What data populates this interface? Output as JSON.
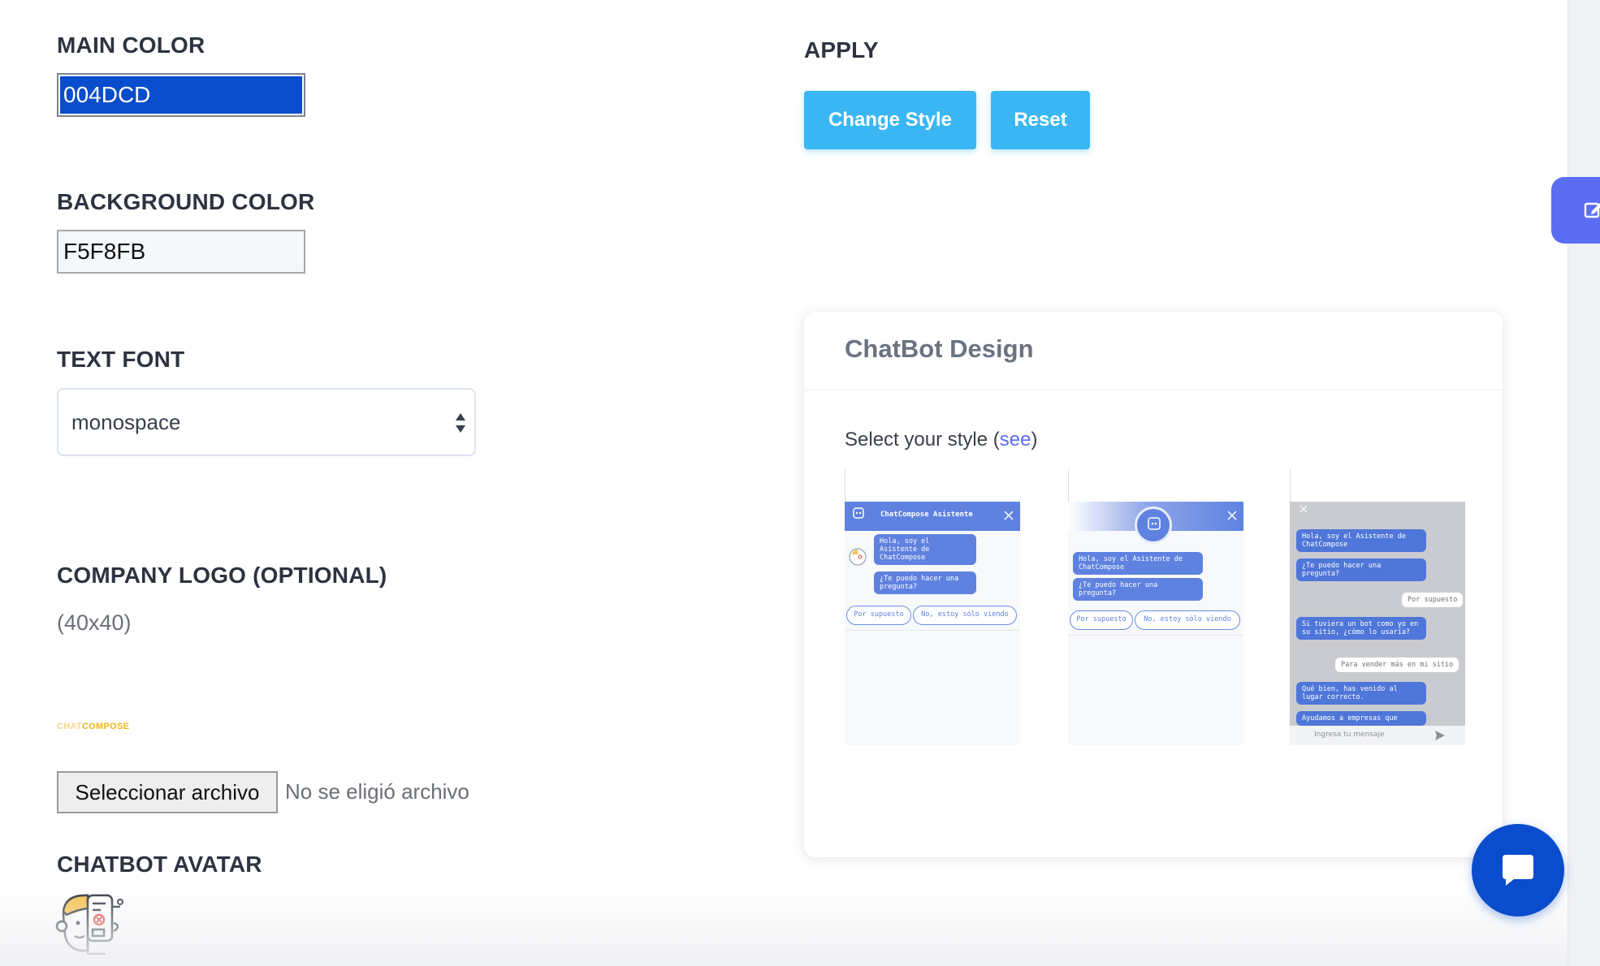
{
  "colors": {
    "main": "#004DCD",
    "background": "#F5F8FB",
    "button": "#3AB7F3",
    "accent": "#5B6EF2",
    "logo_light": "#F6D58A",
    "logo_dark": "#F0B41C"
  },
  "form": {
    "main_color": {
      "label": "MAIN COLOR",
      "value": "004DCD"
    },
    "background_color": {
      "label": "BACKGROUND COLOR",
      "value": "F5F8FB"
    },
    "text_font": {
      "label": "TEXT FONT",
      "value": "monospace"
    },
    "company_logo": {
      "label": "COMPANY LOGO (OPTIONAL)",
      "size_note": "(40x40)",
      "preview_text_a": "CHAT",
      "preview_text_b": "COMPOSE",
      "file_button": "Seleccionar archivo",
      "file_status": "No se eligió archivo"
    },
    "chatbot_avatar": {
      "label": "CHATBOT AVATAR",
      "icon": "robot-avatar-icon"
    }
  },
  "apply": {
    "label": "APPLY",
    "change_style_button": "Change Style",
    "reset_button": "Reset"
  },
  "side_tab": {
    "icon": "edit-icon"
  },
  "design_card": {
    "title": "ChatBot Design",
    "select_prefix": "Select your style (",
    "see_link": "see",
    "select_suffix": ")",
    "styles": [
      {
        "header_title": "ChatCompose Asistente",
        "bubble_1": "Hola, soy el Asistente de ChatCompose",
        "bubble_2": "¿Te puedo hacer una pregunta?",
        "chip_1": "Por supuesto",
        "chip_2": "No, estoy sólo viendo"
      },
      {
        "bubble_1": "Hola, soy el Asistente de ChatCompose",
        "bubble_2": "¿Te puedo hacer una pregunta?",
        "chip_1": "Por supuesto",
        "chip_2": "No, estoy sólo viendo"
      },
      {
        "bubble_1": "Hola, soy el Asistente de ChatCompose",
        "bubble_2": "¿Te puedo hacer una pregunta?",
        "user_1": "Por supuesto",
        "bubble_3": "Si tuviera un bot como yo en su sitio, ¿cómo lo usaría?",
        "user_2": "Para vender más en mi sitio",
        "bubble_4": "Qué bien, has venido al lugar correcto.",
        "bubble_5": "Ayudamos a empresas que",
        "input_placeholder": "Ingresa tu mensaje"
      }
    ]
  },
  "chat_fab": {
    "icon": "chat-bubble-icon"
  }
}
